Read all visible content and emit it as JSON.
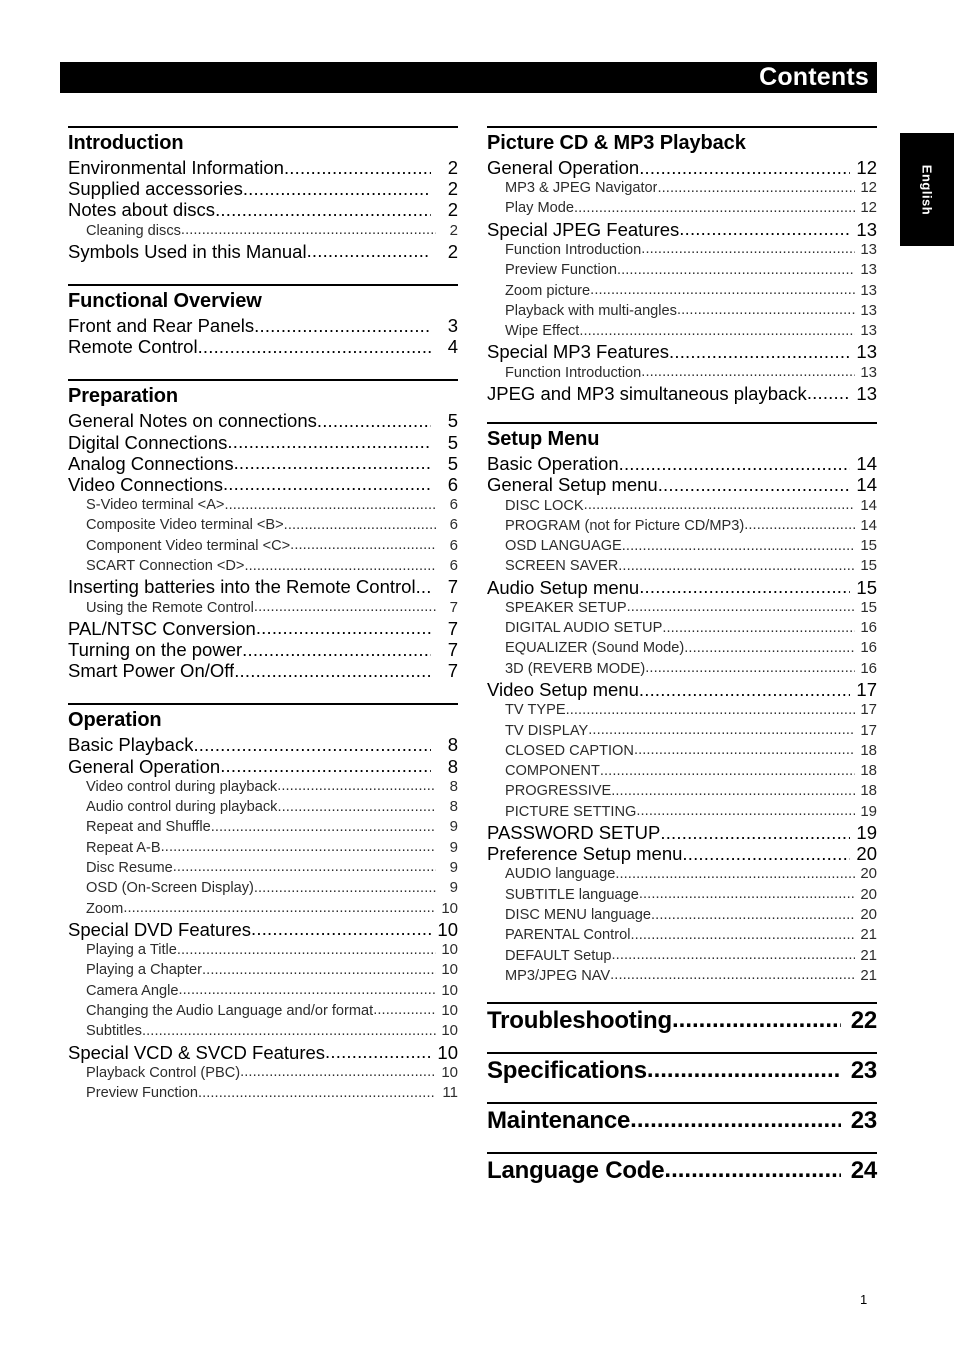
{
  "document": {
    "header_title": "Contents",
    "language_tab": "English",
    "page_number": "1"
  },
  "left_column": [
    {
      "title": "Introduction",
      "entries": [
        {
          "level": 1,
          "label": "Environmental Information",
          "page": "2"
        },
        {
          "level": 1,
          "label": "Supplied accessories",
          "page": "2"
        },
        {
          "level": 1,
          "label": "Notes about discs",
          "page": "2"
        },
        {
          "level": 2,
          "label": "Cleaning discs",
          "page": "2"
        },
        {
          "level": 1,
          "label": "Symbols Used in this Manual",
          "page": "2"
        }
      ]
    },
    {
      "title": "Functional Overview",
      "entries": [
        {
          "level": 1,
          "label": "Front and Rear Panels",
          "page": "3"
        },
        {
          "level": 1,
          "label": "Remote Control",
          "page": "4"
        }
      ]
    },
    {
      "title": "Preparation",
      "entries": [
        {
          "level": 1,
          "label": "General Notes on connections",
          "page": "5"
        },
        {
          "level": 1,
          "label": "Digital Connections",
          "page": "5"
        },
        {
          "level": 1,
          "label": "Analog Connections",
          "page": "5"
        },
        {
          "level": 1,
          "label": "Video Connections",
          "page": "6"
        },
        {
          "level": 2,
          "label": "S-Video terminal <A>",
          "page": "6"
        },
        {
          "level": 2,
          "label": "Composite Video terminal <B>",
          "page": "6"
        },
        {
          "level": 2,
          "label": "Component Video terminal <C>",
          "page": "6"
        },
        {
          "level": 2,
          "label": "SCART Connection <D>",
          "page": "6"
        },
        {
          "level": 1,
          "label": "Inserting batteries into the Remote Control",
          "page": "7"
        },
        {
          "level": 2,
          "label": "Using the Remote Control",
          "page": "7"
        },
        {
          "level": 1,
          "label": "PAL/NTSC Conversion",
          "page": "7"
        },
        {
          "level": 1,
          "label": "Turning on the power",
          "page": "7"
        },
        {
          "level": 1,
          "label": "Smart Power On/Off",
          "page": "7"
        }
      ]
    },
    {
      "title": "Operation",
      "entries": [
        {
          "level": 1,
          "label": "Basic Playback",
          "page": "8"
        },
        {
          "level": 1,
          "label": "General Operation",
          "page": "8"
        },
        {
          "level": 2,
          "label": "Video control during playback",
          "page": "8"
        },
        {
          "level": 2,
          "label": "Audio control during playback",
          "page": "8"
        },
        {
          "level": 2,
          "label": "Repeat and Shuffle",
          "page": "9"
        },
        {
          "level": 2,
          "label": "Repeat A-B",
          "page": "9"
        },
        {
          "level": 2,
          "label": "Disc Resume",
          "page": "9"
        },
        {
          "level": 2,
          "label": "OSD (On-Screen Display)",
          "page": "9"
        },
        {
          "level": 2,
          "label": "Zoom",
          "page": "10"
        },
        {
          "level": 1,
          "label": "Special DVD Features",
          "page": "10"
        },
        {
          "level": 2,
          "label": "Playing a Title",
          "page": "10"
        },
        {
          "level": 2,
          "label": "Playing a Chapter",
          "page": "10"
        },
        {
          "level": 2,
          "label": "Camera Angle",
          "page": "10"
        },
        {
          "level": 2,
          "label": "Changing the Audio Language and/or format",
          "page": "10"
        },
        {
          "level": 2,
          "label": "Subtitles",
          "page": "10"
        },
        {
          "level": 1,
          "label": "Special VCD & SVCD Features",
          "page": "10"
        },
        {
          "level": 2,
          "label": "Playback Control (PBC)",
          "page": "10"
        },
        {
          "level": 2,
          "label": "Preview Function",
          "page": "11"
        }
      ]
    }
  ],
  "right_column": [
    {
      "title": "Picture CD & MP3 Playback",
      "entries": [
        {
          "level": 1,
          "label": "General Operation",
          "page": "12"
        },
        {
          "level": 2,
          "label": "MP3 & JPEG Navigator",
          "page": "12"
        },
        {
          "level": 2,
          "label": "Play Mode",
          "page": "12"
        },
        {
          "level": 1,
          "label": "Special JPEG Features",
          "page": "13"
        },
        {
          "level": 2,
          "label": "Function Introduction",
          "page": "13"
        },
        {
          "level": 2,
          "label": "Preview Function",
          "page": "13"
        },
        {
          "level": 2,
          "label": "Zoom picture",
          "page": "13"
        },
        {
          "level": 2,
          "label": "Playback with multi-angles",
          "page": "13"
        },
        {
          "level": 2,
          "label": "Wipe Effect",
          "page": "13"
        },
        {
          "level": 1,
          "label": "Special MP3 Features",
          "page": "13"
        },
        {
          "level": 2,
          "label": "Function Introduction",
          "page": "13"
        },
        {
          "level": 1,
          "label": "JPEG and MP3 simultaneous playback",
          "page": "13"
        }
      ]
    },
    {
      "title": "Setup Menu",
      "entries": [
        {
          "level": 1,
          "label": "Basic Operation",
          "page": "14"
        },
        {
          "level": 1,
          "label": "General Setup menu",
          "page": "14"
        },
        {
          "level": 2,
          "label": "DISC LOCK",
          "page": "14"
        },
        {
          "level": 2,
          "label": "PROGRAM (not for Picture CD/MP3)",
          "page": "14"
        },
        {
          "level": 2,
          "label": "OSD LANGUAGE",
          "page": "15"
        },
        {
          "level": 2,
          "label": "SCREEN SAVER",
          "page": "15"
        },
        {
          "level": 1,
          "label": "Audio Setup menu",
          "page": "15"
        },
        {
          "level": 2,
          "label": "SPEAKER SETUP",
          "page": "15"
        },
        {
          "level": 2,
          "label": "DIGITAL AUDIO SETUP",
          "page": "16"
        },
        {
          "level": 2,
          "label": "EQUALIZER (Sound Mode)",
          "page": "16"
        },
        {
          "level": 2,
          "label": "3D (REVERB MODE)",
          "page": "16"
        },
        {
          "level": 1,
          "label": "Video Setup menu",
          "page": "17"
        },
        {
          "level": 2,
          "label": "TV TYPE",
          "page": "17"
        },
        {
          "level": 2,
          "label": "TV DISPLAY",
          "page": "17"
        },
        {
          "level": 2,
          "label": "CLOSED CAPTION",
          "page": "18"
        },
        {
          "level": 2,
          "label": "COMPONENT",
          "page": "18"
        },
        {
          "level": 2,
          "label": "PROGRESSIVE",
          "page": "18"
        },
        {
          "level": 2,
          "label": "PICTURE SETTING",
          "page": "19"
        },
        {
          "level": 1,
          "label": "PASSWORD SETUP",
          "page": "19"
        },
        {
          "level": 1,
          "label": "Preference Setup menu",
          "page": "20"
        },
        {
          "level": 2,
          "label": "AUDIO language",
          "page": "20"
        },
        {
          "level": 2,
          "label": "SUBTITLE language",
          "page": "20"
        },
        {
          "level": 2,
          "label": "DISC MENU language",
          "page": "20"
        },
        {
          "level": 2,
          "label": "PARENTAL Control",
          "page": "21"
        },
        {
          "level": 2,
          "label": "DEFAULT Setup",
          "page": "21"
        },
        {
          "level": 2,
          "label": "MP3/JPEG NAV",
          "page": "21"
        }
      ]
    }
  ],
  "right_column_big_entries": [
    {
      "label": "Troubleshooting",
      "page": "22"
    },
    {
      "label": "Specifications",
      "page": "23"
    },
    {
      "label": "Maintenance",
      "page": "23"
    },
    {
      "label": "Language Code",
      "page": "24"
    }
  ]
}
